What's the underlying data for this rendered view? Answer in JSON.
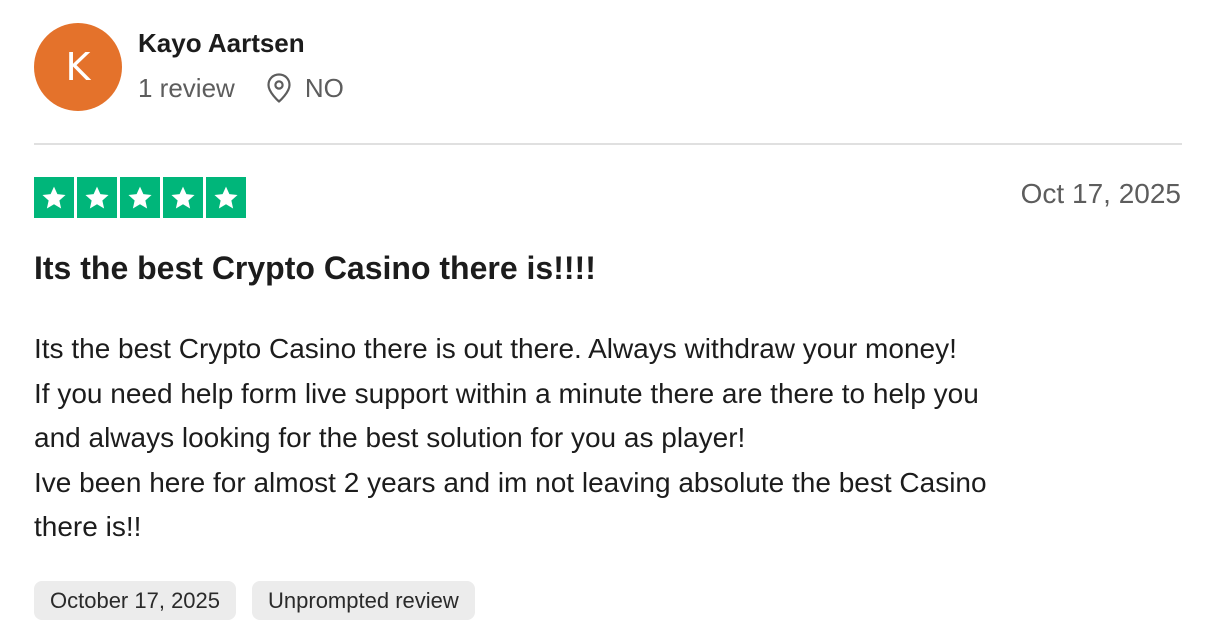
{
  "reviewer": {
    "initial": "K",
    "name": "Kayo Aartsen",
    "review_count": "1 review",
    "country": "NO",
    "avatar_color": "#e4722b",
    "location_icon": "location-pin-icon"
  },
  "review": {
    "rating": 5,
    "max_rating": 5,
    "star_color": "#00b67a",
    "date": "Oct 17, 2025",
    "title": "Its the best Crypto Casino there is!!!!",
    "body_lines": [
      "Its the best Crypto Casino there is out there. Always withdraw your money!",
      "If you need help form live support within a minute there are there to help you",
      "and always looking for the best solution for you as player!",
      "Ive been here for almost 2 years and im not leaving absolute the best Casino",
      "there is!!"
    ],
    "tags": [
      "October 17, 2025",
      "Unprompted review"
    ]
  }
}
